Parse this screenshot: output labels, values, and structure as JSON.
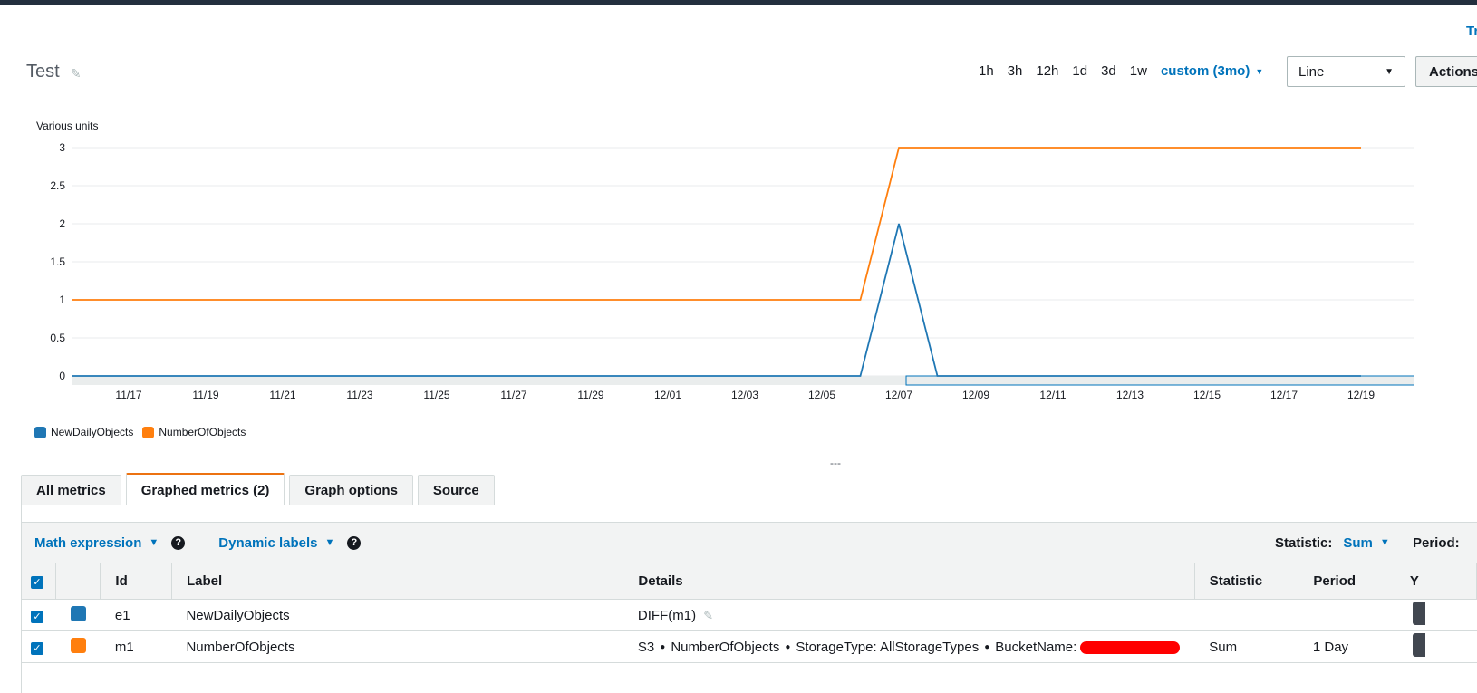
{
  "header": {
    "top_link": "Tr",
    "title": "Test"
  },
  "time_range": {
    "buttons": [
      "1h",
      "3h",
      "12h",
      "1d",
      "3d",
      "1w"
    ],
    "custom": "custom (3mo)"
  },
  "graph_type": "Line",
  "actions_label": "Actions",
  "chart_data": {
    "type": "line",
    "ylabel": "Various units",
    "ylim": [
      0,
      3
    ],
    "yticks": [
      "3",
      "2.5",
      "2",
      "1.5",
      "1",
      "0.5",
      "0"
    ],
    "ytick_values": [
      3,
      2.5,
      2,
      1.5,
      1,
      0.5,
      0
    ],
    "xticks": [
      "11/17",
      "11/19",
      "11/21",
      "11/23",
      "11/25",
      "11/27",
      "11/29",
      "12/01",
      "12/03",
      "12/05",
      "12/07",
      "12/09",
      "12/11",
      "12/13",
      "12/15",
      "12/17",
      "12/19"
    ],
    "x": [
      "11/17",
      "11/18",
      "11/19",
      "11/20",
      "11/21",
      "11/22",
      "11/23",
      "11/24",
      "11/25",
      "11/26",
      "11/27",
      "11/28",
      "11/29",
      "11/30",
      "12/01",
      "12/02",
      "12/03",
      "12/04",
      "12/05",
      "12/06",
      "12/07",
      "12/08",
      "12/09",
      "12/10",
      "12/11",
      "12/12",
      "12/13",
      "12/14",
      "12/15",
      "12/16",
      "12/17",
      "12/18",
      "12/19"
    ],
    "grid": true,
    "legend_position": "bottom-left",
    "series": [
      {
        "name": "NewDailyObjects",
        "color": "#1f77b4",
        "values": [
          0,
          0,
          0,
          0,
          0,
          0,
          0,
          0,
          0,
          0,
          0,
          0,
          0,
          0,
          0,
          0,
          0,
          0,
          0,
          0,
          2,
          0,
          0,
          0,
          0,
          0,
          0,
          0,
          0,
          0,
          0,
          0,
          0
        ]
      },
      {
        "name": "NumberOfObjects",
        "color": "#ff7f0e",
        "values": [
          1,
          1,
          1,
          1,
          1,
          1,
          1,
          1,
          1,
          1,
          1,
          1,
          1,
          1,
          1,
          1,
          1,
          1,
          1,
          1,
          3,
          3,
          3,
          3,
          3,
          3,
          3,
          3,
          3,
          3,
          3,
          3,
          3
        ]
      }
    ]
  },
  "resize_handle": "---",
  "tabs": [
    {
      "label": "All metrics",
      "active": false
    },
    {
      "label": "Graphed metrics (2)",
      "active": true
    },
    {
      "label": "Graph options",
      "active": false
    },
    {
      "label": "Source",
      "active": false
    }
  ],
  "toolbar": {
    "math_expression": "Math expression",
    "dynamic_labels": "Dynamic labels",
    "help": "?",
    "statistic_label": "Statistic:",
    "statistic_value": "Sum",
    "period_label": "Period:"
  },
  "table": {
    "headers": {
      "id": "Id",
      "label": "Label",
      "details": "Details",
      "statistic": "Statistic",
      "period": "Period",
      "y": "Y"
    },
    "rows": [
      {
        "id": "e1",
        "label": "NewDailyObjects",
        "color": "#1f77b4",
        "details": "DIFF(m1)",
        "statistic": "",
        "period": ""
      },
      {
        "id": "m1",
        "label": "NumberOfObjects",
        "color": "#ff7f0e",
        "details_parts": [
          "S3",
          "NumberOfObjects",
          "StorageType: AllStorageTypes",
          "BucketName:"
        ],
        "statistic": "Sum",
        "period": "1 Day"
      }
    ]
  },
  "icons": {
    "checkbox": "✓",
    "edit": "✎",
    "dropdown": "▼",
    "chevron": "⌄",
    "bullet": "●"
  }
}
